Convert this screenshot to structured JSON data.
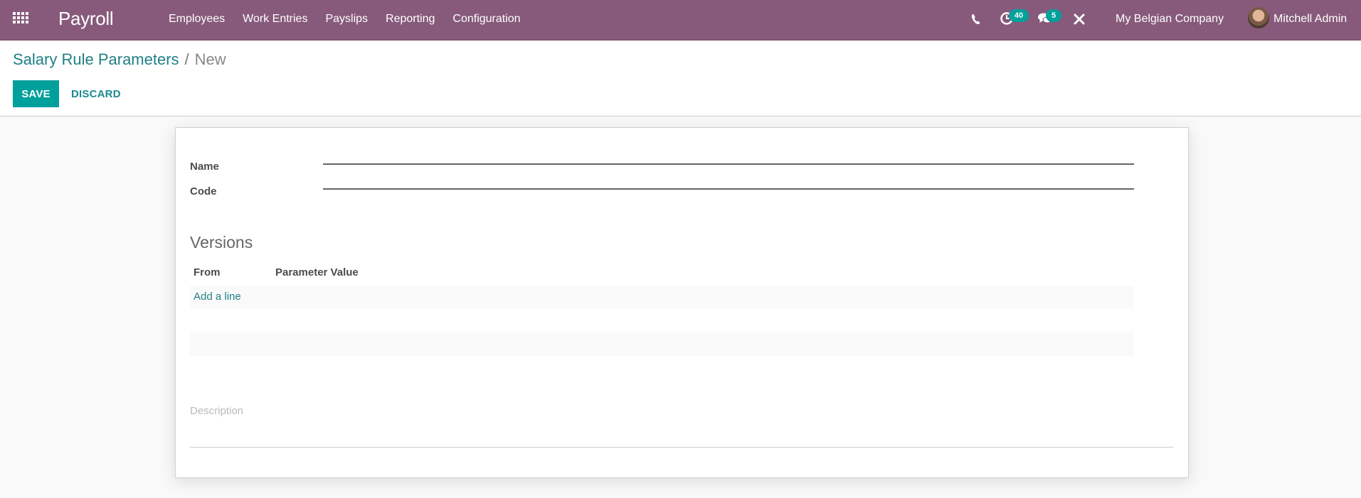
{
  "navbar": {
    "app_title": "Payroll",
    "menu": [
      "Employees",
      "Work Entries",
      "Payslips",
      "Reporting",
      "Configuration"
    ],
    "activity_count": "40",
    "message_count": "5",
    "company": "My Belgian Company",
    "user": "Mitchell Admin",
    "color": "#875a7b"
  },
  "breadcrumb": {
    "parent": "Salary Rule Parameters",
    "separator": "/",
    "current": "New"
  },
  "buttons": {
    "save": "SAVE",
    "discard": "DISCARD"
  },
  "form": {
    "name_label": "Name",
    "name_value": "",
    "code_label": "Code",
    "code_value": "",
    "versions_title": "Versions",
    "columns": [
      "From",
      "Parameter Value"
    ],
    "add_line": "Add a line",
    "description_placeholder": "Description"
  },
  "colors": {
    "accent": "#00a09d",
    "link": "#1f7f86"
  }
}
